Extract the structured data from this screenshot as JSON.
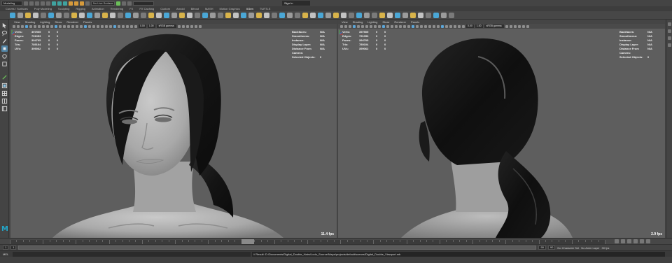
{
  "app": {
    "mode": "Modeling",
    "sign_in": "Sign In"
  },
  "status_fields": [
    "No Live Surface",
    "",
    ""
  ],
  "shelf_tabs": [
    "Curves / Surfaces",
    "Poly Modeling",
    "Sculpting",
    "Rigging",
    "Animation",
    "Rendering",
    "FX",
    "FX Caching",
    "Custom",
    "Arnold",
    "Bifrost",
    "MASH",
    "Motion Graphics",
    "XGen",
    "TURTLE"
  ],
  "active_shelf_tab": "XGen",
  "viewport_menus": [
    "View",
    "Shading",
    "Lighting",
    "Show",
    "Renderer",
    "Panels"
  ],
  "viewport_icon_values": {
    "near": "0.00",
    "far": "1.00",
    "colorspace": "sRGB gamma"
  },
  "hud_left_header": [
    "verts:",
    "",
    ""
  ],
  "hud_left": [
    {
      "label": "Verts:",
      "a": "397505",
      "b": "0",
      "c": "0"
    },
    {
      "label": "Edges:",
      "a": "791053",
      "b": "0",
      "c": "0"
    },
    {
      "label": "Faces:",
      "a": "394705",
      "b": "0",
      "c": "0"
    },
    {
      "label": "Tris:",
      "a": "789104",
      "b": "0",
      "c": "0"
    },
    {
      "label": "UVs:",
      "a": "399062",
      "b": "0",
      "c": "0"
    }
  ],
  "hud_right": [
    {
      "label": "Backfaces:",
      "value": "N/A"
    },
    {
      "label": "Smoothness:",
      "value": "N/A"
    },
    {
      "label": "Instance:",
      "value": "N/A"
    },
    {
      "label": "Display Layer:",
      "value": "N/A"
    },
    {
      "label": "Distance From Camera:",
      "value": "N/A"
    },
    {
      "label": "Selected Objects:",
      "value": "0"
    }
  ],
  "viewports": [
    {
      "fps": "11.4 fps",
      "view": "front three-quarter"
    },
    {
      "fps": "2.9 fps",
      "view": "back"
    }
  ],
  "range": {
    "start": "1",
    "inner_start": "1",
    "inner_end": "90",
    "end": "90",
    "character_set": "No Character Set",
    "anim_layer": "No Anim Layer",
    "fps": "30 fps"
  },
  "command_line": {
    "mel_label": "MEL",
    "result": "// Result: D:/Documents/Digital_Double_Hairs/Lodo_Source/Maya/projects/default/scenes/Digital_Double_Viewport.mb"
  },
  "colors": {
    "accent": "#22a6c9",
    "viewport_bg": "#5e5e5e",
    "ui_bg": "#444444"
  }
}
